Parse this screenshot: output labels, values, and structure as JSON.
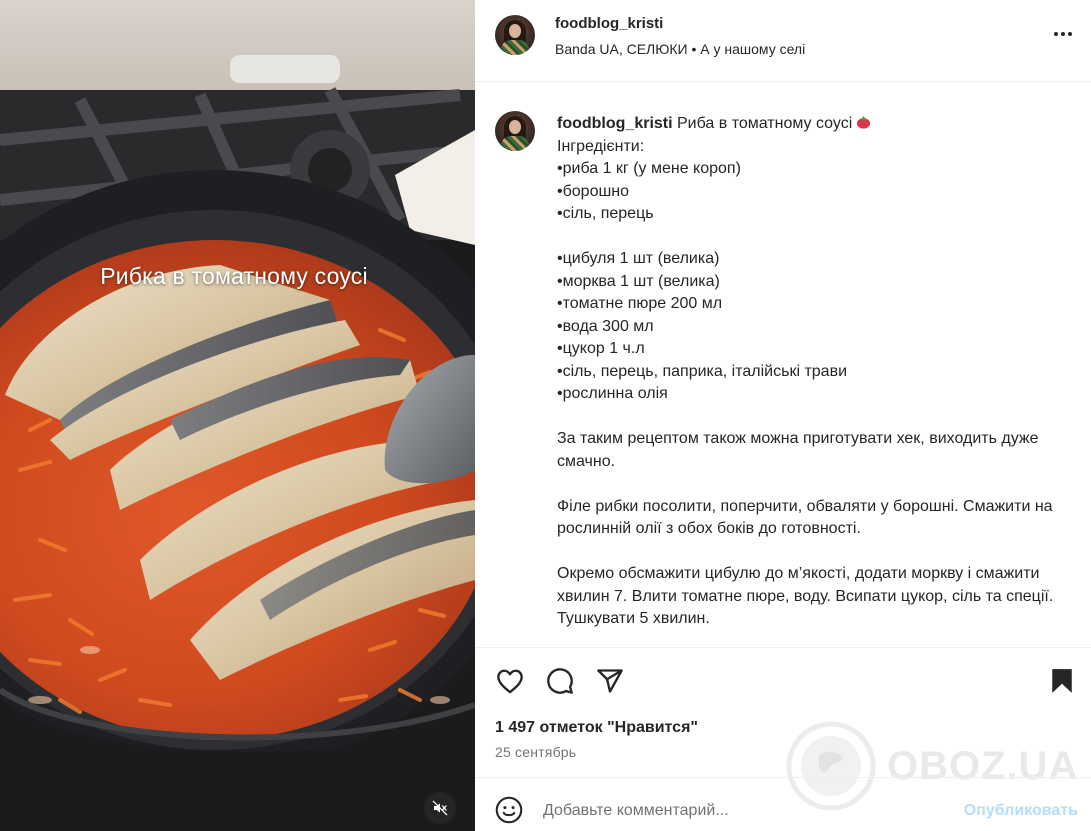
{
  "media": {
    "overlay_caption": "Рибка в томатному соусі",
    "mute_icon": "speaker-muted-icon"
  },
  "post_header": {
    "username": "foodblog_kristi",
    "audio": "Banda UA, СЕЛЮКИ • А у нашому селі",
    "more_icon": "more-horizontal-icon"
  },
  "caption": {
    "username": "foodblog_kristi",
    "title": " Риба в томатному соусі",
    "title_emoji": "tomato-emoji",
    "body": "\nІнгредієнти:\n•риба 1 кг (у мене короп)\n•борошно\n•сіль, перець\n\n•цибуля 1 шт (велика)\n•морква 1 шт (велика)\n•томатне пюре 200 мл\n•вода 300 мл\n•цукор 1 ч.л\n•сіль, перець, паприка, італійські трави\n•рослинна олія\n\nЗа таким рецептом також можна приготувати хек, виходить дуже смачно.\n\nФіле рибки посолити, поперчити, обваляти у борошні. Смажити на рослинній олії з обох боків до готовності.\n\nОкремо обсмажити цибулю до м’якості, додати моркву і смажити хвилин 7. Влити томатне пюре, воду. Всипати цукор, сіль та спеції. Тушкувати 5 хвилин."
  },
  "actions": {
    "like_icon": "heart-outline-icon",
    "comment_icon": "comment-bubble-icon",
    "share_icon": "paper-plane-icon",
    "save_icon": "bookmark-filled-icon",
    "likes_text": "1 497 отметок \"Нравится\"",
    "date_text": "25 сентябрь"
  },
  "watermark": {
    "text": "OBOZ.UA"
  },
  "comment": {
    "emoji_icon": "smiley-icon",
    "placeholder": "Добавьте комментарий...",
    "publish_label": "Опубликовать"
  },
  "colors": {
    "text": "#262626",
    "secondary": "#737373",
    "publish_disabled": "#b2dffc",
    "divider": "#efefef"
  }
}
